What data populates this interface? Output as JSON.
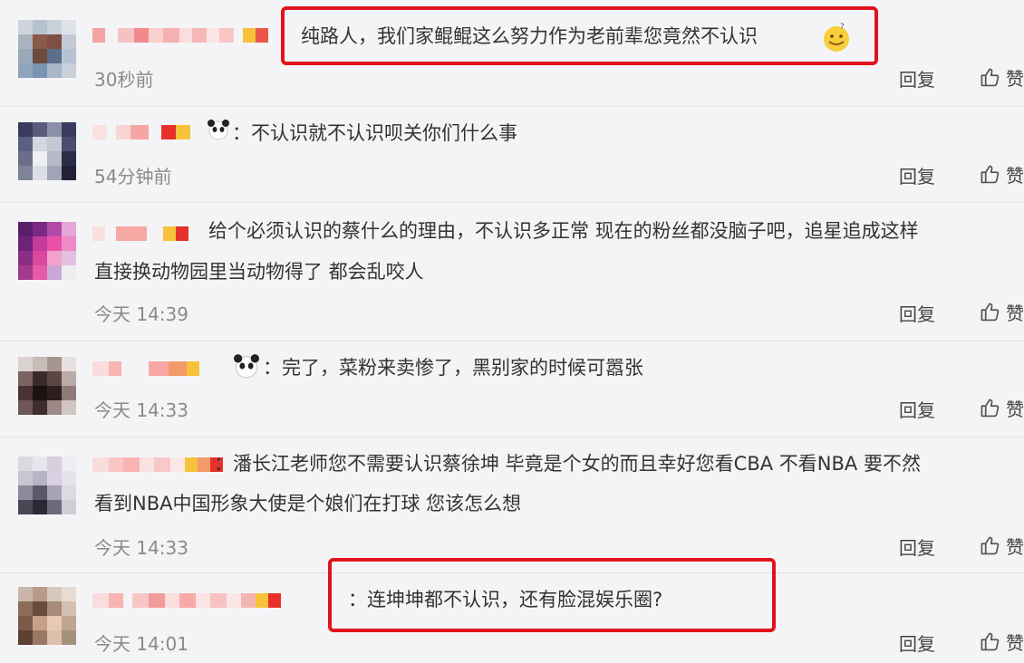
{
  "comments": [
    {
      "content": "纯路人，我们家鲲鲲这么努力作为老前辈您竟然不认识",
      "time": "30秒前",
      "reply": "回复",
      "like": "赞"
    },
    {
      "content": "：不认识就不认识呗关你们什么事",
      "time": "54分钟前",
      "reply": "回复",
      "like": "赞"
    },
    {
      "content": "给个必须认识的蔡什么的理由，不认识多正常 现在的粉丝都没脑子吧，追星追成这样",
      "content2": "直接换动物园里当动物得了 都会乱咬人",
      "time": "今天 14:39",
      "reply": "回复",
      "like": "赞"
    },
    {
      "content": "：完了，菜粉来卖惨了，黑别家的时候可嚣张",
      "time": "今天 14:33",
      "reply": "回复",
      "like": "赞"
    },
    {
      "content": "：潘长江老师您不需要认识蔡徐坤 毕竟是个女的而且幸好您看CBA 不看NBA 要不然",
      "content2": "看到NBA中国形象大使是个娘们在打球 您该怎么想",
      "time": "今天 14:33",
      "reply": "回复",
      "like": "赞"
    },
    {
      "content": "：连坤坤都不认识，还有脸混娱乐圈?",
      "time": "今天 14:01",
      "reply": "回复",
      "like": "赞"
    }
  ],
  "colors": {
    "highlight": "#e0141e",
    "background": "#f4f4f6",
    "meta": "#8a8a8a"
  }
}
